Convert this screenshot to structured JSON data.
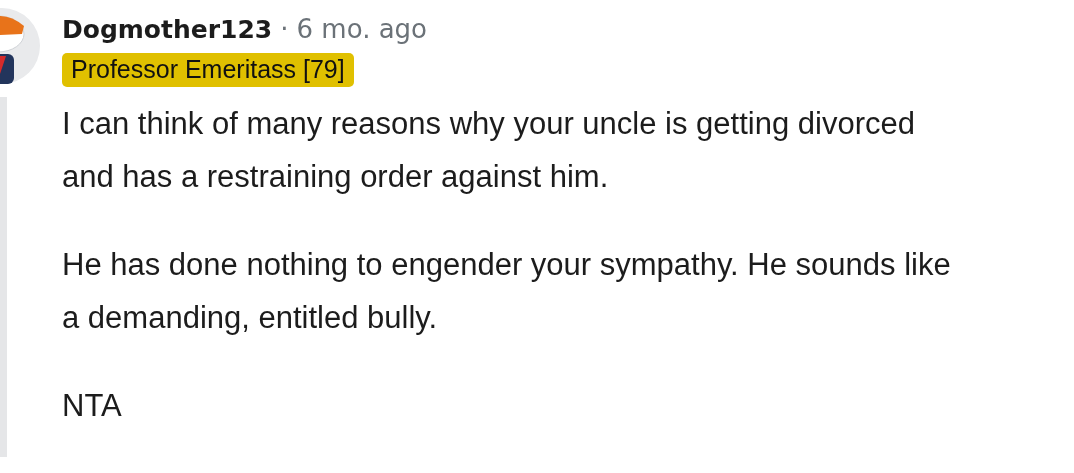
{
  "comment": {
    "author": "Dogmother123",
    "separator": "·",
    "time": "6 mo. ago",
    "flair": {
      "text": "Professor Emeritass [79]",
      "color": "#e0c000"
    },
    "paragraphs": [
      "I can think of many reasons why your uncle is getting divorced and has a restraining order against him.",
      "He has done nothing to engender your sympathy. He sounds like a demanding, entitled bully.",
      "NTA"
    ]
  }
}
